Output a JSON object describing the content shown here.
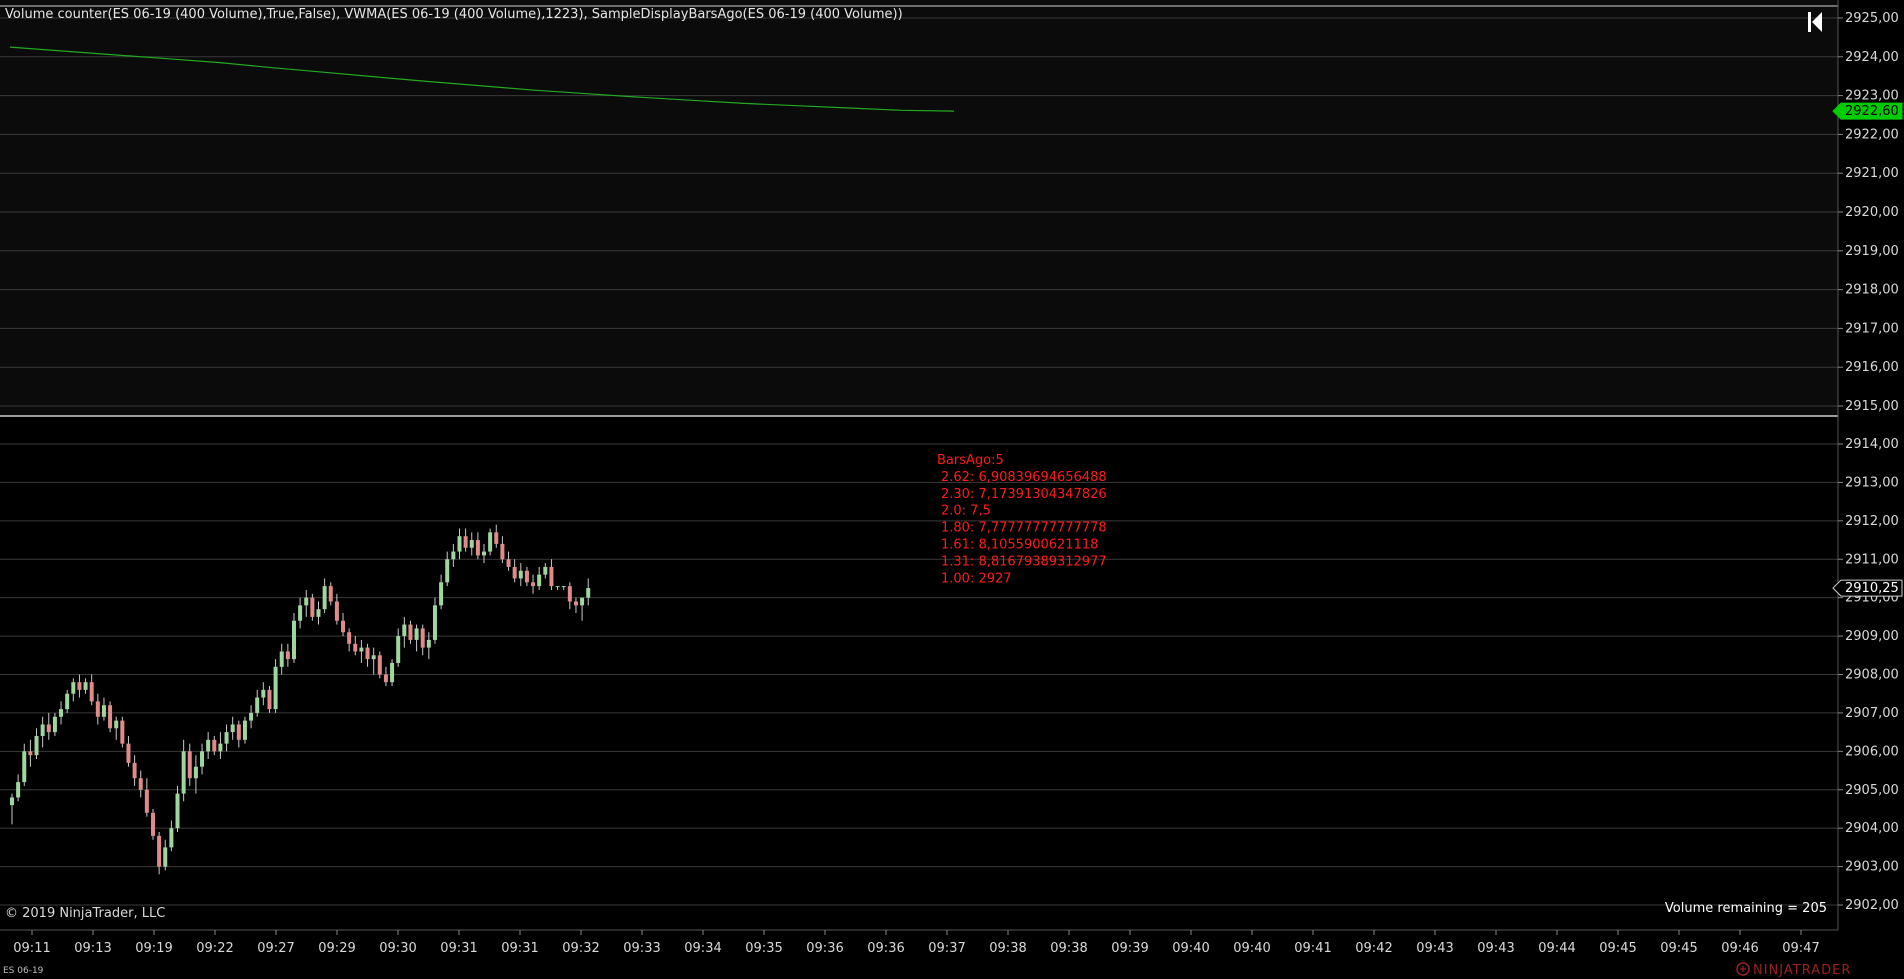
{
  "header": {
    "indicator_title": "Volume counter(ES 06-19 (400 Volume),True,False), VWMA(ES 06-19 (400 Volume),1223), SampleDisplayBarsAgo(ES 06-19 (400 Volume))",
    "scroll_icon": "skip-to-end-icon"
  },
  "footer": {
    "copyright": "© 2019 NinjaTrader, LLC",
    "volume_remaining": "Volume remaining = 205",
    "instrument": "ES 06-19",
    "brand": "NINJATRADER",
    "brand_icon": "ninjatrader-logo-icon"
  },
  "colors": {
    "background_top": "#0b0b0b",
    "background_bottom": "#000000",
    "grid": "#3a3a3a",
    "separator": "#d0d0d0",
    "up_candle": "#9fd59f",
    "down_candle": "#e08a8a",
    "wick": "#c8c8c8",
    "vwma_line": "#22aa22",
    "vwma_marker": "#00cc00",
    "price_marker_bg": "#000000",
    "annotation": "#ff1a1a",
    "brand": "#9a2020"
  },
  "chart_data": [
    {
      "type": "line",
      "panel": "top",
      "series": [
        {
          "values": [
            2924.25,
            2924.15,
            2924.05,
            2923.95,
            2923.85,
            2923.72,
            2923.6,
            2923.48,
            2923.36,
            2923.25,
            2923.14,
            2923.05,
            2922.96,
            2922.88,
            2922.8,
            2922.74,
            2922.68,
            2922.62,
            2922.6
          ]
        }
      ],
      "last_value_label": "2922,60",
      "y_ticks": [
        "2925,00",
        "2924,00",
        "2923,00",
        "2922,00",
        "2921,00",
        "2920,00",
        "2919,00",
        "2918,00",
        "2917,00",
        "2916,00",
        "2915,00"
      ],
      "ylim": [
        2915.0,
        2925.0
      ],
      "grid": true
    },
    {
      "type": "candlestick",
      "panel": "bottom",
      "series": [
        {
          "ohlc": [
            [
              2904.6,
              2904.9,
              2904.1,
              2904.8
            ],
            [
              2904.8,
              2905.4,
              2904.7,
              2905.2
            ],
            [
              2905.2,
              2906.2,
              2905.1,
              2906.0
            ],
            [
              2906.0,
              2906.3,
              2905.6,
              2905.9
            ],
            [
              2905.9,
              2906.6,
              2905.8,
              2906.4
            ],
            [
              2906.4,
              2906.9,
              2906.1,
              2906.7
            ],
            [
              2906.7,
              2907.0,
              2906.3,
              2906.5
            ],
            [
              2906.5,
              2907.0,
              2906.4,
              2906.9
            ],
            [
              2906.9,
              2907.3,
              2906.7,
              2907.1
            ],
            [
              2907.1,
              2907.6,
              2907.0,
              2907.5
            ],
            [
              2907.5,
              2907.9,
              2907.3,
              2907.8
            ],
            [
              2907.8,
              2908.0,
              2907.4,
              2907.6
            ],
            [
              2907.6,
              2907.9,
              2907.5,
              2907.8
            ],
            [
              2907.8,
              2908.0,
              2907.2,
              2907.3
            ],
            [
              2907.3,
              2907.5,
              2906.7,
              2906.9
            ],
            [
              2906.9,
              2907.4,
              2906.8,
              2907.2
            ],
            [
              2907.2,
              2907.3,
              2906.5,
              2906.6
            ],
            [
              2906.6,
              2906.9,
              2906.3,
              2906.8
            ],
            [
              2906.8,
              2906.9,
              2906.1,
              2906.2
            ],
            [
              2906.2,
              2906.4,
              2905.6,
              2905.7
            ],
            [
              2905.7,
              2905.9,
              2905.1,
              2905.3
            ],
            [
              2905.3,
              2905.5,
              2904.8,
              2905.0
            ],
            [
              2905.0,
              2905.3,
              2904.3,
              2904.4
            ],
            [
              2904.4,
              2904.5,
              2903.7,
              2903.8
            ],
            [
              2903.8,
              2903.9,
              2902.8,
              2903.0
            ],
            [
              2903.0,
              2903.7,
              2902.9,
              2903.5
            ],
            [
              2903.5,
              2904.2,
              2903.4,
              2904.0
            ],
            [
              2904.0,
              2905.1,
              2903.9,
              2904.9
            ],
            [
              2904.9,
              2906.3,
              2904.7,
              2906.0
            ],
            [
              2906.0,
              2906.2,
              2905.1,
              2905.3
            ],
            [
              2905.3,
              2905.9,
              2904.9,
              2905.6
            ],
            [
              2905.6,
              2906.2,
              2905.4,
              2906.0
            ],
            [
              2906.0,
              2906.5,
              2905.8,
              2906.3
            ],
            [
              2906.3,
              2906.4,
              2905.9,
              2906.0
            ],
            [
              2906.0,
              2906.5,
              2905.8,
              2906.2
            ],
            [
              2906.2,
              2906.7,
              2906.0,
              2906.5
            ],
            [
              2906.5,
              2906.9,
              2906.3,
              2906.7
            ],
            [
              2906.7,
              2906.8,
              2906.1,
              2906.3
            ],
            [
              2906.3,
              2906.9,
              2906.2,
              2906.8
            ],
            [
              2906.8,
              2907.2,
              2906.6,
              2907.0
            ],
            [
              2907.0,
              2907.6,
              2906.9,
              2907.4
            ],
            [
              2907.4,
              2907.8,
              2907.2,
              2907.6
            ],
            [
              2907.6,
              2907.7,
              2907.0,
              2907.1
            ],
            [
              2907.1,
              2908.4,
              2907.0,
              2908.2
            ],
            [
              2908.2,
              2908.8,
              2908.0,
              2908.6
            ],
            [
              2908.6,
              2908.8,
              2908.2,
              2908.4
            ],
            [
              2908.4,
              2909.6,
              2908.3,
              2909.4
            ],
            [
              2909.4,
              2910.0,
              2909.2,
              2909.8
            ],
            [
              2909.8,
              2910.2,
              2909.5,
              2910.0
            ],
            [
              2910.0,
              2910.1,
              2909.4,
              2909.5
            ],
            [
              2909.5,
              2909.9,
              2909.3,
              2909.7
            ],
            [
              2909.7,
              2910.5,
              2909.6,
              2910.3
            ],
            [
              2910.3,
              2910.4,
              2909.8,
              2909.9
            ],
            [
              2909.9,
              2910.1,
              2909.3,
              2909.4
            ],
            [
              2909.4,
              2909.6,
              2909.0,
              2909.1
            ],
            [
              2909.1,
              2909.2,
              2908.6,
              2908.8
            ],
            [
              2908.8,
              2909.0,
              2908.5,
              2908.6
            ],
            [
              2908.6,
              2908.9,
              2908.3,
              2908.7
            ],
            [
              2908.7,
              2908.8,
              2908.2,
              2908.4
            ],
            [
              2908.4,
              2908.7,
              2908.0,
              2908.5
            ],
            [
              2908.5,
              2908.6,
              2907.9,
              2908.0
            ],
            [
              2908.0,
              2908.2,
              2907.7,
              2907.8
            ],
            [
              2907.8,
              2908.4,
              2907.7,
              2908.3
            ],
            [
              2908.3,
              2909.2,
              2908.2,
              2909.0
            ],
            [
              2909.0,
              2909.5,
              2908.7,
              2909.3
            ],
            [
              2909.3,
              2909.4,
              2908.8,
              2908.9
            ],
            [
              2908.9,
              2909.3,
              2908.6,
              2909.2
            ],
            [
              2909.2,
              2909.3,
              2908.5,
              2908.7
            ],
            [
              2908.7,
              2909.1,
              2908.4,
              2908.9
            ],
            [
              2908.9,
              2910.0,
              2908.8,
              2909.8
            ],
            [
              2909.8,
              2910.6,
              2909.7,
              2910.4
            ],
            [
              2910.4,
              2911.2,
              2910.3,
              2911.0
            ],
            [
              2911.0,
              2911.4,
              2910.8,
              2911.2
            ],
            [
              2911.2,
              2911.8,
              2911.0,
              2911.6
            ],
            [
              2911.6,
              2911.8,
              2911.2,
              2911.3
            ],
            [
              2911.3,
              2911.7,
              2911.1,
              2911.5
            ],
            [
              2911.5,
              2911.7,
              2911.0,
              2911.1
            ],
            [
              2911.1,
              2911.4,
              2910.9,
              2911.2
            ],
            [
              2911.2,
              2911.8,
              2911.1,
              2911.7
            ],
            [
              2911.7,
              2911.9,
              2911.3,
              2911.4
            ],
            [
              2911.4,
              2911.6,
              2910.9,
              2911.0
            ],
            [
              2911.0,
              2911.2,
              2910.7,
              2910.8
            ],
            [
              2910.8,
              2911.0,
              2910.4,
              2910.5
            ],
            [
              2910.5,
              2910.9,
              2910.3,
              2910.7
            ],
            [
              2910.7,
              2910.8,
              2910.3,
              2910.4
            ],
            [
              2910.4,
              2910.6,
              2910.1,
              2910.3
            ],
            [
              2910.3,
              2910.8,
              2910.2,
              2910.6
            ],
            [
              2910.6,
              2910.9,
              2910.5,
              2910.8
            ],
            [
              2910.8,
              2911.0,
              2910.2,
              2910.3
            ],
            [
              2910.3,
              2910.3,
              2910.2,
              2910.3
            ],
            [
              2910.3,
              2910.3,
              2910.2,
              2910.3
            ],
            [
              2910.3,
              2910.4,
              2909.7,
              2909.9
            ],
            [
              2909.9,
              2910.0,
              2909.6,
              2909.8
            ],
            [
              2909.8,
              2910.0,
              2909.4,
              2910.0
            ],
            [
              2910.0,
              2910.5,
              2909.8,
              2910.25
            ]
          ]
        }
      ],
      "last_value_label": "2910,25",
      "y_ticks": [
        "2914,00",
        "2913,00",
        "2912,00",
        "2911,00",
        "2910,00",
        "2909,00",
        "2908,00",
        "2907,00",
        "2906,00",
        "2905,00",
        "2904,00",
        "2903,00",
        "2902,00"
      ],
      "ylim": [
        2902.0,
        2914.0
      ],
      "x_ticks": [
        "09:11",
        "09:13",
        "09:19",
        "09:22",
        "09:27",
        "09:29",
        "09:30",
        "09:31",
        "09:31",
        "09:32",
        "09:33",
        "09:34",
        "09:35",
        "09:36",
        "09:36",
        "09:37",
        "09:38",
        "09:38",
        "09:39",
        "09:40",
        "09:40",
        "09:41",
        "09:42",
        "09:43",
        "09:43",
        "09:44",
        "09:45",
        "09:45",
        "09:46",
        "09:47"
      ],
      "grid": true,
      "annotations": [
        "BarsAgo:5",
        "2.62: 6,90839694656488",
        "2.30: 7,17391304347826",
        "2.0: 7,5",
        "1.80: 7,77777777777778",
        "1.61: 8,1055900621118",
        "1.31: 8,81679389312977",
        "1.00: 2927"
      ]
    }
  ]
}
